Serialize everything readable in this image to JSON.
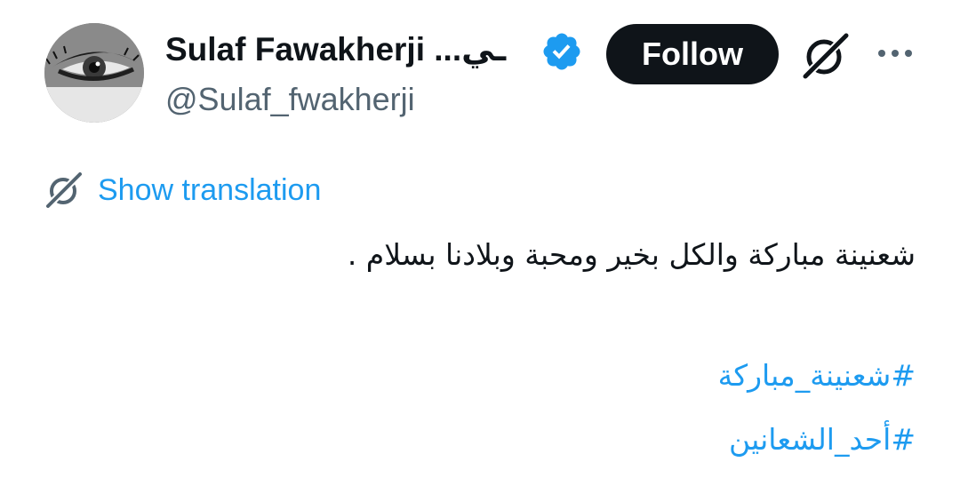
{
  "author": {
    "name": "Sulaf Fawakherji ...ـي",
    "handle": "@Sulaf_fwakherji",
    "avatar_icon": "profile-avatar-eye-image"
  },
  "header": {
    "follow_label": "Follow",
    "grok_icon": "grok-icon",
    "more_icon": "more-options-icon"
  },
  "translation": {
    "icon": "translate-icon",
    "label": "Show translation"
  },
  "tweet": {
    "text": "شعنينة مباركة والكل بخير ومحبة وبلادنا بسلام .",
    "hashtags": [
      "#شعنينة_مباركة",
      "#أحد_الشعانين"
    ]
  },
  "colors": {
    "link": "#1d9bf0",
    "verified": "#1d9bf0",
    "text": "#0f1419",
    "secondary": "#536471",
    "button_bg": "#0f1419"
  }
}
